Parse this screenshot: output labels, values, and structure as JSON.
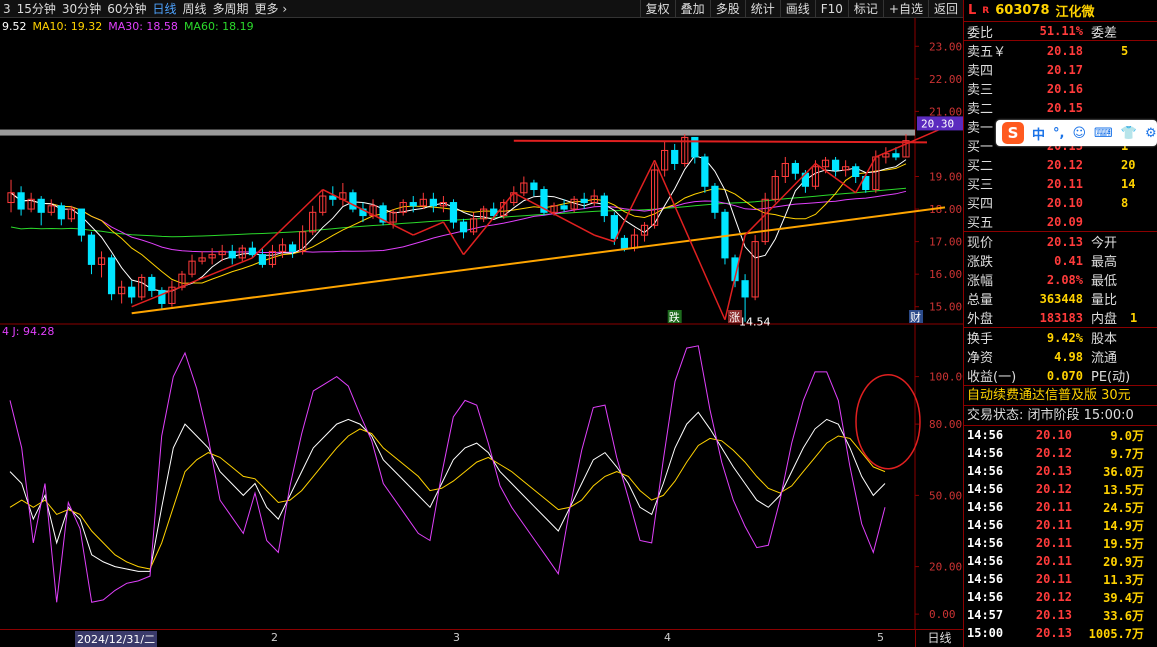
{
  "toolbar": {
    "periods": [
      "3",
      "15分钟",
      "30分钟",
      "60分钟",
      "日线",
      "周线",
      "多周期",
      "更多 ›"
    ],
    "active_period": "日线",
    "tools": [
      "复权",
      "叠加",
      "多股",
      "统计",
      "画线",
      "F10",
      "标记",
      "+自选",
      "返回"
    ]
  },
  "ma": {
    "ma5": "9.52",
    "ma10": "MA10: 19.32",
    "ma30": "MA30: 18.58",
    "ma60": "MA60: 18.19"
  },
  "kdj": {
    "label": "4  J: 94.28"
  },
  "price_axis": [
    "23.00",
    "22.00",
    "21.00",
    "20.30",
    "19.00",
    "18.00",
    "17.00",
    "16.00",
    "15.00"
  ],
  "kdj_axis": [
    "100.00",
    "80.00",
    "50.00",
    "20.00",
    "0.00"
  ],
  "annotations": {
    "high_price": "20.30",
    "low_price": "14.54",
    "tags": [
      "跌",
      "涨",
      "财"
    ]
  },
  "dates": [
    "2024/12/31/二",
    "2",
    "3",
    "4",
    "5"
  ],
  "period_switch": "日线",
  "stock": {
    "market": "L",
    "rz": "R",
    "code": "603078",
    "name": "江化微"
  },
  "weibi": {
    "label": "委比",
    "value": "51.11%",
    "label2": "委差",
    "value2": ""
  },
  "asks": [
    {
      "label": "卖五￥",
      "price": "20.18",
      "vol": "5"
    },
    {
      "label": "卖四",
      "price": "20.17",
      "vol": ""
    },
    {
      "label": "卖三",
      "price": "20.16",
      "vol": ""
    },
    {
      "label": "卖二",
      "price": "20.15",
      "vol": ""
    },
    {
      "label": "卖一",
      "price": "",
      "vol": ""
    }
  ],
  "bids": [
    {
      "label": "买一",
      "price": "20.13",
      "vol": "1"
    },
    {
      "label": "买二",
      "price": "20.12",
      "vol": "20"
    },
    {
      "label": "买三",
      "price": "20.11",
      "vol": "14"
    },
    {
      "label": "买四",
      "price": "20.10",
      "vol": "8"
    },
    {
      "label": "买五",
      "price": "20.09",
      "vol": ""
    }
  ],
  "quote": [
    {
      "l": "现价",
      "v": "20.13",
      "l2": "今开",
      "v2": ""
    },
    {
      "l": "涨跌",
      "v": "0.41",
      "l2": "最高",
      "v2": ""
    },
    {
      "l": "涨幅",
      "v": "2.08%",
      "l2": "最低",
      "v2": ""
    },
    {
      "l": "总量",
      "v": "363448",
      "l2": "量比",
      "v2": ""
    },
    {
      "l": "外盘",
      "v": "183183",
      "l2": "内盘",
      "v2": "1"
    }
  ],
  "fund": [
    {
      "l": "换手",
      "v": "9.42%",
      "l2": "股本",
      "v2": ""
    },
    {
      "l": "净资",
      "v": "4.98",
      "l2": "流通",
      "v2": ""
    },
    {
      "l": "收益(一)",
      "v": "0.070",
      "l2": "PE(动)",
      "v2": ""
    }
  ],
  "ad_banner": "自动续费通达信普及版  30元",
  "trade_status": "交易状态: 闭市阶段 15:00:0",
  "ticks": [
    {
      "t": "14:56",
      "p": "20.10",
      "v": "9.0万"
    },
    {
      "t": "14:56",
      "p": "20.12",
      "v": "9.7万"
    },
    {
      "t": "14:56",
      "p": "20.13",
      "v": "36.0万"
    },
    {
      "t": "14:56",
      "p": "20.12",
      "v": "13.5万"
    },
    {
      "t": "14:56",
      "p": "20.11",
      "v": "24.5万"
    },
    {
      "t": "14:56",
      "p": "20.11",
      "v": "14.9万"
    },
    {
      "t": "14:56",
      "p": "20.11",
      "v": "19.5万"
    },
    {
      "t": "14:56",
      "p": "20.11",
      "v": "20.9万"
    },
    {
      "t": "14:56",
      "p": "20.11",
      "v": "11.3万"
    },
    {
      "t": "14:56",
      "p": "20.12",
      "v": "39.4万"
    },
    {
      "t": "14:57",
      "p": "20.13",
      "v": "33.6万"
    },
    {
      "t": "15:00",
      "p": "20.13",
      "v": "1005.7万"
    }
  ],
  "ime": {
    "items": [
      "中",
      "°,",
      "☺",
      "⌨",
      "👕",
      "⚙"
    ]
  },
  "colors": {
    "up": "#ff3b3b",
    "down": "#00e5ff",
    "ma5": "#ffffff",
    "ma10": "#ffd200",
    "ma30": "#e040fb",
    "ma60": "#2bd92b"
  },
  "chart_data": [
    {
      "type": "candlestick",
      "title": "江化微 603078 日线",
      "ylim": [
        14.5,
        23.5
      ],
      "x": [
        "2024/12/31",
        "",
        "",
        "",
        "",
        "",
        "",
        "",
        "",
        "",
        "",
        "",
        "",
        "",
        "",
        "",
        "",
        "",
        "",
        "",
        "",
        "",
        "",
        "",
        "",
        "",
        "",
        "",
        "",
        "",
        "",
        "",
        "",
        "",
        "",
        "",
        "",
        "",
        "",
        "",
        "",
        "",
        "",
        "",
        "",
        "",
        "",
        "",
        "",
        "",
        "",
        "",
        "",
        "",
        "",
        "",
        "",
        "",
        "",
        "",
        "",
        "",
        "",
        "",
        "",
        "",
        "",
        "",
        "",
        "",
        "",
        "",
        "",
        "",
        "",
        "",
        "",
        "",
        "",
        "",
        "",
        "",
        "",
        "",
        "",
        "",
        "",
        "",
        "",
        "",
        "",
        "",
        "",
        "",
        ""
      ],
      "candles": [
        {
          "o": 18.2,
          "c": 18.5,
          "h": 18.9,
          "l": 17.9
        },
        {
          "o": 18.5,
          "c": 18.0,
          "h": 18.7,
          "l": 17.8
        },
        {
          "o": 18.0,
          "c": 18.3,
          "h": 18.5,
          "l": 17.9
        },
        {
          "o": 18.3,
          "c": 17.9,
          "h": 18.4,
          "l": 17.5
        },
        {
          "o": 17.9,
          "c": 18.1,
          "h": 18.3,
          "l": 17.8
        },
        {
          "o": 18.1,
          "c": 17.7,
          "h": 18.2,
          "l": 17.5
        },
        {
          "o": 17.7,
          "c": 18.0,
          "h": 18.1,
          "l": 17.6
        },
        {
          "o": 18.0,
          "c": 17.2,
          "h": 18.0,
          "l": 17.0
        },
        {
          "o": 17.2,
          "c": 16.3,
          "h": 17.3,
          "l": 16.0
        },
        {
          "o": 16.3,
          "c": 16.5,
          "h": 16.7,
          "l": 15.9
        },
        {
          "o": 16.5,
          "c": 15.4,
          "h": 16.6,
          "l": 15.2
        },
        {
          "o": 15.4,
          "c": 15.6,
          "h": 15.8,
          "l": 15.1
        },
        {
          "o": 15.6,
          "c": 15.3,
          "h": 15.8,
          "l": 15.1
        },
        {
          "o": 15.3,
          "c": 15.9,
          "h": 16.0,
          "l": 15.2
        },
        {
          "o": 15.9,
          "c": 15.5,
          "h": 16.0,
          "l": 15.3
        },
        {
          "o": 15.5,
          "c": 15.1,
          "h": 15.6,
          "l": 14.9
        },
        {
          "o": 15.1,
          "c": 15.6,
          "h": 15.8,
          "l": 15.0
        },
        {
          "o": 15.6,
          "c": 16.0,
          "h": 16.1,
          "l": 15.5
        },
        {
          "o": 16.0,
          "c": 16.4,
          "h": 16.6,
          "l": 15.9
        },
        {
          "o": 16.4,
          "c": 16.5,
          "h": 16.7,
          "l": 16.3
        },
        {
          "o": 16.5,
          "c": 16.6,
          "h": 16.8,
          "l": 16.3
        },
        {
          "o": 16.6,
          "c": 16.7,
          "h": 16.9,
          "l": 16.4
        },
        {
          "o": 16.7,
          "c": 16.5,
          "h": 16.9,
          "l": 16.3
        },
        {
          "o": 16.5,
          "c": 16.8,
          "h": 16.9,
          "l": 16.4
        },
        {
          "o": 16.8,
          "c": 16.6,
          "h": 17.0,
          "l": 16.5
        },
        {
          "o": 16.6,
          "c": 16.3,
          "h": 16.8,
          "l": 16.2
        },
        {
          "o": 16.3,
          "c": 16.7,
          "h": 16.9,
          "l": 16.2
        },
        {
          "o": 16.7,
          "c": 16.9,
          "h": 17.1,
          "l": 16.5
        },
        {
          "o": 16.9,
          "c": 16.7,
          "h": 17.0,
          "l": 16.5
        },
        {
          "o": 16.7,
          "c": 17.3,
          "h": 17.5,
          "l": 16.6
        },
        {
          "o": 17.3,
          "c": 17.9,
          "h": 18.1,
          "l": 17.2
        },
        {
          "o": 17.9,
          "c": 18.4,
          "h": 18.6,
          "l": 17.8
        },
        {
          "o": 18.4,
          "c": 18.3,
          "h": 18.7,
          "l": 18.1
        },
        {
          "o": 18.3,
          "c": 18.5,
          "h": 18.8,
          "l": 18.1
        },
        {
          "o": 18.5,
          "c": 18.0,
          "h": 18.6,
          "l": 17.9
        },
        {
          "o": 18.0,
          "c": 17.8,
          "h": 18.2,
          "l": 17.6
        },
        {
          "o": 17.8,
          "c": 18.1,
          "h": 18.3,
          "l": 17.7
        },
        {
          "o": 18.1,
          "c": 17.6,
          "h": 18.2,
          "l": 17.5
        },
        {
          "o": 17.6,
          "c": 17.9,
          "h": 18.0,
          "l": 17.4
        },
        {
          "o": 17.9,
          "c": 18.2,
          "h": 18.3,
          "l": 17.8
        },
        {
          "o": 18.2,
          "c": 18.1,
          "h": 18.4,
          "l": 17.9
        },
        {
          "o": 18.1,
          "c": 18.3,
          "h": 18.5,
          "l": 18.0
        },
        {
          "o": 18.3,
          "c": 18.1,
          "h": 18.5,
          "l": 17.9
        },
        {
          "o": 18.1,
          "c": 18.2,
          "h": 18.4,
          "l": 17.9
        },
        {
          "o": 18.2,
          "c": 17.6,
          "h": 18.3,
          "l": 17.4
        },
        {
          "o": 17.6,
          "c": 17.3,
          "h": 17.7,
          "l": 17.1
        },
        {
          "o": 17.3,
          "c": 17.7,
          "h": 17.9,
          "l": 17.2
        },
        {
          "o": 17.7,
          "c": 18.0,
          "h": 18.1,
          "l": 17.6
        },
        {
          "o": 18.0,
          "c": 17.8,
          "h": 18.2,
          "l": 17.7
        },
        {
          "o": 17.8,
          "c": 18.2,
          "h": 18.3,
          "l": 17.7
        },
        {
          "o": 18.2,
          "c": 18.5,
          "h": 18.7,
          "l": 18.1
        },
        {
          "o": 18.5,
          "c": 18.8,
          "h": 19.0,
          "l": 18.4
        },
        {
          "o": 18.8,
          "c": 18.6,
          "h": 18.9,
          "l": 18.4
        },
        {
          "o": 18.6,
          "c": 17.9,
          "h": 18.7,
          "l": 17.8
        },
        {
          "o": 17.9,
          "c": 18.1,
          "h": 18.2,
          "l": 17.8
        },
        {
          "o": 18.1,
          "c": 18.0,
          "h": 18.3,
          "l": 17.9
        },
        {
          "o": 18.0,
          "c": 18.3,
          "h": 18.4,
          "l": 17.9
        },
        {
          "o": 18.3,
          "c": 18.2,
          "h": 18.5,
          "l": 18.0
        },
        {
          "o": 18.2,
          "c": 18.4,
          "h": 18.6,
          "l": 18.1
        },
        {
          "o": 18.4,
          "c": 17.8,
          "h": 18.5,
          "l": 17.6
        },
        {
          "o": 17.8,
          "c": 17.1,
          "h": 17.9,
          "l": 16.9
        },
        {
          "o": 17.1,
          "c": 16.8,
          "h": 17.2,
          "l": 16.7
        },
        {
          "o": 16.8,
          "c": 17.2,
          "h": 17.4,
          "l": 16.7
        },
        {
          "o": 17.2,
          "c": 17.5,
          "h": 17.6,
          "l": 17.0
        },
        {
          "o": 17.5,
          "c": 19.2,
          "h": 19.4,
          "l": 17.4
        },
        {
          "o": 19.2,
          "c": 19.8,
          "h": 20.1,
          "l": 19.0
        },
        {
          "o": 19.8,
          "c": 19.4,
          "h": 20.0,
          "l": 19.2
        },
        {
          "o": 19.4,
          "c": 20.2,
          "h": 20.3,
          "l": 19.3
        },
        {
          "o": 20.2,
          "c": 19.6,
          "h": 20.2,
          "l": 19.4
        },
        {
          "o": 19.6,
          "c": 18.7,
          "h": 19.7,
          "l": 18.5
        },
        {
          "o": 18.7,
          "c": 17.9,
          "h": 18.8,
          "l": 17.7
        },
        {
          "o": 17.9,
          "c": 16.5,
          "h": 18.0,
          "l": 16.3
        },
        {
          "o": 16.5,
          "c": 15.8,
          "h": 16.6,
          "l": 15.6
        },
        {
          "o": 15.8,
          "c": 15.3,
          "h": 16.0,
          "l": 14.54
        },
        {
          "o": 15.3,
          "c": 17.0,
          "h": 17.2,
          "l": 15.2
        },
        {
          "o": 17.0,
          "c": 18.3,
          "h": 18.5,
          "l": 16.9
        },
        {
          "o": 18.3,
          "c": 19.0,
          "h": 19.2,
          "l": 18.2
        },
        {
          "o": 19.0,
          "c": 19.4,
          "h": 19.6,
          "l": 18.8
        },
        {
          "o": 19.4,
          "c": 19.1,
          "h": 19.5,
          "l": 18.9
        },
        {
          "o": 19.1,
          "c": 18.7,
          "h": 19.2,
          "l": 18.5
        },
        {
          "o": 18.7,
          "c": 19.3,
          "h": 19.5,
          "l": 18.6
        },
        {
          "o": 19.3,
          "c": 19.5,
          "h": 19.6,
          "l": 19.1
        },
        {
          "o": 19.5,
          "c": 19.2,
          "h": 19.6,
          "l": 19.0
        },
        {
          "o": 19.2,
          "c": 19.3,
          "h": 19.5,
          "l": 19.0
        },
        {
          "o": 19.3,
          "c": 19.0,
          "h": 19.4,
          "l": 18.8
        },
        {
          "o": 19.0,
          "c": 18.6,
          "h": 19.1,
          "l": 18.5
        },
        {
          "o": 18.6,
          "c": 19.6,
          "h": 19.8,
          "l": 18.5
        },
        {
          "o": 19.6,
          "c": 19.7,
          "h": 19.9,
          "l": 19.4
        },
        {
          "o": 19.7,
          "c": 19.6,
          "h": 19.9,
          "l": 19.5
        },
        {
          "o": 19.6,
          "c": 20.1,
          "h": 20.3,
          "l": 19.6
        }
      ]
    },
    {
      "type": "line",
      "title": "",
      "ylim": [
        -5,
        115
      ],
      "series": [
        {
          "name": "K",
          "color": "#ffffff",
          "values": [
            60,
            55,
            40,
            50,
            30,
            45,
            40,
            25,
            22,
            20,
            19,
            18,
            18,
            45,
            70,
            80,
            75,
            70,
            60,
            55,
            50,
            55,
            45,
            40,
            50,
            60,
            70,
            75,
            80,
            82,
            80,
            75,
            65,
            60,
            55,
            50,
            45,
            55,
            65,
            70,
            72,
            68,
            60,
            55,
            50,
            45,
            40,
            35,
            45,
            55,
            65,
            68,
            62,
            55,
            45,
            42,
            55,
            70,
            80,
            85,
            78,
            70,
            62,
            55,
            48,
            45,
            50,
            60,
            70,
            78,
            82,
            80,
            70,
            58,
            50,
            55
          ]
        },
        {
          "name": "D",
          "color": "#ffd200",
          "values": [
            45,
            48,
            45,
            48,
            42,
            44,
            42,
            35,
            30,
            25,
            22,
            20,
            19,
            30,
            45,
            60,
            65,
            68,
            66,
            62,
            58,
            57,
            52,
            47,
            48,
            52,
            58,
            64,
            70,
            75,
            78,
            76,
            70,
            66,
            62,
            58,
            52,
            53,
            56,
            60,
            64,
            66,
            63,
            60,
            56,
            52,
            48,
            44,
            45,
            48,
            54,
            58,
            60,
            58,
            52,
            48,
            50,
            56,
            64,
            71,
            74,
            73,
            69,
            64,
            58,
            53,
            51,
            54,
            60,
            66,
            72,
            75,
            74,
            68,
            62,
            60
          ]
        },
        {
          "name": "J",
          "color": "#e040fb",
          "values": [
            90,
            70,
            30,
            55,
            5,
            47,
            36,
            5,
            6,
            10,
            13,
            14,
            16,
            75,
            100,
            110,
            95,
            74,
            48,
            41,
            34,
            51,
            31,
            26,
            54,
            76,
            94,
            97,
            100,
            96,
            84,
            73,
            55,
            48,
            41,
            34,
            31,
            59,
            83,
            90,
            88,
            72,
            54,
            45,
            38,
            31,
            24,
            17,
            45,
            69,
            87,
            88,
            66,
            49,
            31,
            30,
            65,
            98,
            112,
            113,
            86,
            64,
            48,
            37,
            28,
            29,
            48,
            72,
            90,
            102,
            102,
            90,
            62,
            38,
            26,
            45
          ]
        }
      ],
      "annotations": [
        {
          "label": "J",
          "value": "94.28"
        }
      ]
    }
  ]
}
